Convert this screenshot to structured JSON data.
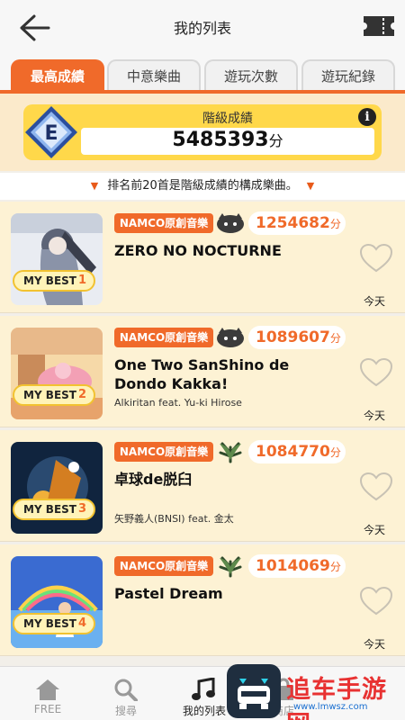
{
  "header": {
    "title": "我的列表"
  },
  "tabs": [
    {
      "label": "最高成績",
      "active": true
    },
    {
      "label": "中意樂曲",
      "active": false
    },
    {
      "label": "遊玩次數",
      "active": false
    },
    {
      "label": "遊玩紀錄",
      "active": false
    }
  ],
  "grade": {
    "badge_letter": "E",
    "label": "階級成績",
    "value": "5485393",
    "unit": "分",
    "info_glyph": "i"
  },
  "notice": {
    "text": "排名前20首是階級成績的構成樂曲。"
  },
  "songs": [
    {
      "category": "NAMCO原創音樂",
      "score": "1254682",
      "unit": "分",
      "title": "ZERO NO NOCTURNE",
      "artist": "",
      "my_best_label": "MY BEST",
      "rank": "1",
      "date": "今天",
      "difficulty_icon": "oni-icon"
    },
    {
      "category": "NAMCO原創音樂",
      "score": "1089607",
      "unit": "分",
      "title": "One Two SanShino de Dondo Kakka!",
      "artist": "Alkiritan feat. Yu-ki Hirose",
      "my_best_label": "MY BEST",
      "rank": "2",
      "date": "今天",
      "difficulty_icon": "oni-icon"
    },
    {
      "category": "NAMCO原創音樂",
      "score": "1084770",
      "unit": "分",
      "title": "卓球de脱臼",
      "artist": "矢野義人(BNSI) feat. 金太",
      "my_best_label": "MY BEST",
      "rank": "3",
      "date": "今天",
      "difficulty_icon": "leaf-icon"
    },
    {
      "category": "NAMCO原創音樂",
      "score": "1014069",
      "unit": "分",
      "title": "Pastel Dream",
      "artist": "",
      "my_best_label": "MY BEST",
      "rank": "4",
      "date": "今天",
      "difficulty_icon": "leaf-icon"
    }
  ],
  "bottom_nav": [
    {
      "label": "FREE",
      "icon": "home-icon"
    },
    {
      "label": "搜尋",
      "icon": "search-icon"
    },
    {
      "label": "我的列表",
      "icon": "music-note-icon"
    },
    {
      "label": "商店",
      "icon": "shop-icon"
    }
  ],
  "watermark": {
    "text": "追车手游网",
    "url": "www.lmwsz.com"
  },
  "colors": {
    "accent": "#f06a2a",
    "badge_yellow": "#ffd84a",
    "row_bg": "#fdf2d4"
  }
}
